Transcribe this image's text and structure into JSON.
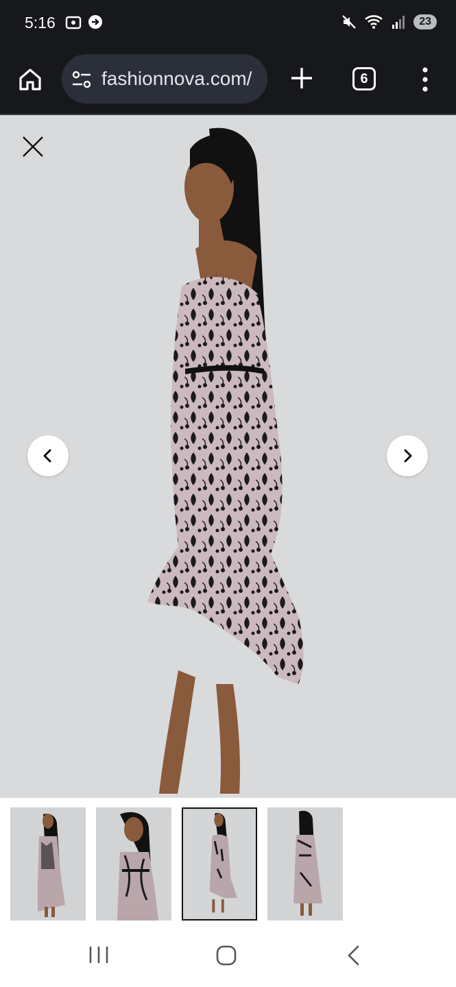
{
  "status_bar": {
    "time": "5:16",
    "battery": "23",
    "icons": [
      "screenshot-icon",
      "message-icon",
      "mute-icon",
      "wifi-icon",
      "signal-icon"
    ]
  },
  "browser": {
    "url": "fashionnova.com/",
    "tab_count": "6",
    "icons": [
      "home-icon",
      "site-settings-icon",
      "plus-icon",
      "tabs-icon",
      "more-vert-icon"
    ]
  },
  "product_viewer": {
    "selected_index": 2,
    "thumbnail_count": 4,
    "icons": [
      "close-icon",
      "chevron-left-icon",
      "chevron-right-icon"
    ]
  },
  "colors": {
    "status_bg": "#17181b",
    "url_bg": "#2b2f3a",
    "viewer_bg": "#d9dadc",
    "dress_base": "#cbb9bd",
    "lace": "#1c1a1c",
    "skin": "#8a5a3c",
    "hair": "#111111"
  },
  "nav": {
    "icons": [
      "recents-icon",
      "home-icon",
      "back-icon"
    ]
  }
}
